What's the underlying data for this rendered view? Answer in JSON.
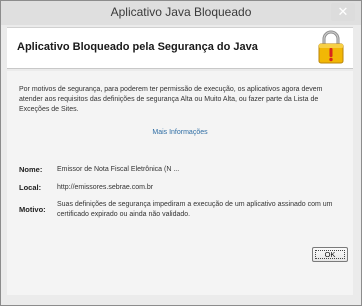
{
  "window": {
    "title": "Aplicativo Java Bloqueado",
    "close_glyph": "✕"
  },
  "header": {
    "title": "Aplicativo Bloqueado pela Segurança do Java",
    "icon": "lock-warning-icon"
  },
  "body": {
    "message": "Por motivos de segurança, para poderem ter permissão de execução, os aplicativos agora devem atender aos requisitos das definições de segurança Alta ou Muito Alta, ou fazer parte da Lista de Exceções de Sites.",
    "more_info_link": "Mais Informações"
  },
  "details": {
    "name_label": "Nome:",
    "name_value": "Emissor de Nota Fiscal Eletrônica (N ...",
    "location_label": "Local:",
    "location_value": "http://emissores.sebrae.com.br",
    "reason_label": "Motivo:",
    "reason_value": "Suas definições de segurança impediram a execução de um aplicativo assinado com um certificado expirado ou ainda não validado."
  },
  "buttons": {
    "ok_label": "OK"
  },
  "colors": {
    "link": "#2e6da4",
    "lock_body": "#f2b705",
    "warning_red": "#d9261c"
  }
}
